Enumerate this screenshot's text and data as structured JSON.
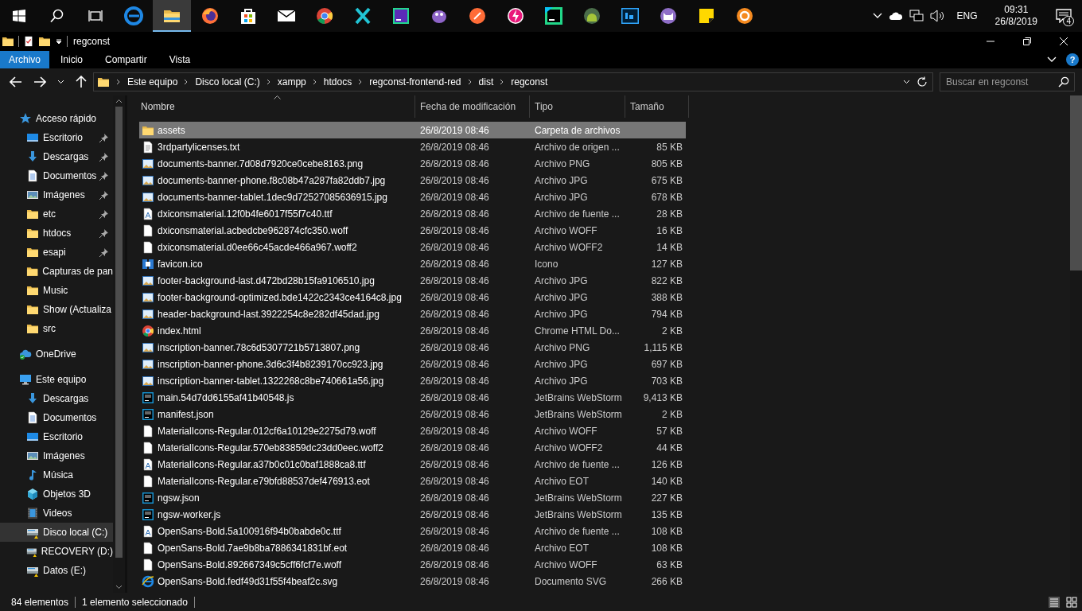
{
  "taskbar": {
    "apps": [
      {
        "kind": "edge",
        "selected": false
      },
      {
        "kind": "explorer",
        "selected": true
      },
      {
        "kind": "firefox",
        "selected": false
      },
      {
        "kind": "store",
        "selected": false
      },
      {
        "kind": "mail",
        "selected": false
      },
      {
        "kind": "chrome",
        "selected": false
      },
      {
        "kind": "xapp",
        "selected": false
      },
      {
        "kind": "dg",
        "selected": false
      },
      {
        "kind": "bird",
        "selected": false
      },
      {
        "kind": "postman",
        "selected": false
      },
      {
        "kind": "bolt",
        "selected": false
      },
      {
        "kind": "ws",
        "selected": false
      },
      {
        "kind": "android",
        "selected": false
      },
      {
        "kind": "ps",
        "selected": false
      },
      {
        "kind": "cat",
        "selected": false
      },
      {
        "kind": "sticky",
        "selected": false
      },
      {
        "kind": "coin",
        "selected": false
      }
    ],
    "language": "ENG",
    "time": "09:31",
    "date": "26/8/2019",
    "notification_count": "4"
  },
  "window": {
    "title": "regconst"
  },
  "ribbon": {
    "tabs": [
      {
        "label": "Archivo",
        "selected": true
      },
      {
        "label": "Inicio",
        "selected": false
      },
      {
        "label": "Compartir",
        "selected": false
      },
      {
        "label": "Vista",
        "selected": false
      }
    ],
    "help": "?"
  },
  "address": {
    "path": [
      "Este equipo",
      "Disco local (C:)",
      "xampp",
      "htdocs",
      "regconst-frontend-red",
      "dist",
      "regconst"
    ],
    "search": {
      "placeholder": "Buscar en regconst"
    }
  },
  "navigation": {
    "sections": [
      {
        "label": "Acceso rápido",
        "kind": "star",
        "selected": false,
        "children": [
          {
            "label": "Escritorio",
            "kind": "desktop",
            "pinned": true,
            "selected": false
          },
          {
            "label": "Descargas",
            "kind": "download",
            "pinned": true,
            "selected": false
          },
          {
            "label": "Documentos",
            "kind": "doc",
            "pinned": true,
            "selected": false
          },
          {
            "label": "Imágenes",
            "kind": "pictures",
            "pinned": true,
            "selected": false
          },
          {
            "label": "etc",
            "kind": "folder",
            "pinned": true,
            "selected": false
          },
          {
            "label": "htdocs",
            "kind": "folder",
            "pinned": true,
            "selected": false
          },
          {
            "label": "esapi",
            "kind": "folder",
            "pinned": true,
            "selected": false
          },
          {
            "label": "Capturas de pan",
            "kind": "folder",
            "pinned": false,
            "selected": false
          },
          {
            "label": "Music",
            "kind": "folder",
            "pinned": false,
            "selected": false
          },
          {
            "label": "Show (Actualiza",
            "kind": "folder",
            "pinned": false,
            "selected": false
          },
          {
            "label": "src",
            "kind": "folder",
            "pinned": false,
            "selected": false
          }
        ]
      },
      {
        "label": "OneDrive",
        "kind": "cloud",
        "selected": false
      },
      {
        "label": "Este equipo",
        "kind": "pc",
        "selected": false,
        "children": [
          {
            "label": "Descargas",
            "kind": "download",
            "pinned": false,
            "selected": false
          },
          {
            "label": "Documentos",
            "kind": "doc",
            "pinned": false,
            "selected": false
          },
          {
            "label": "Escritorio",
            "kind": "desktop",
            "pinned": false,
            "selected": false
          },
          {
            "label": "Imágenes",
            "kind": "pictures",
            "pinned": false,
            "selected": false
          },
          {
            "label": "Música",
            "kind": "music",
            "pinned": false,
            "selected": false
          },
          {
            "label": "Objetos 3D",
            "kind": "cube",
            "pinned": false,
            "selected": false
          },
          {
            "label": "Videos",
            "kind": "video",
            "pinned": false,
            "selected": false
          },
          {
            "label": "Disco local (C:)",
            "kind": "drive",
            "pinned": false,
            "selected": true
          },
          {
            "label": "RECOVERY (D:)",
            "kind": "drive",
            "pinned": false,
            "selected": false
          },
          {
            "label": "Datos (E:)",
            "kind": "drive",
            "pinned": false,
            "selected": false
          }
        ]
      }
    ]
  },
  "table": {
    "columns": [
      {
        "label": "Nombre",
        "sorted": true
      },
      {
        "label": "Fecha de modificación",
        "sorted": false
      },
      {
        "label": "Tipo",
        "sorted": false
      },
      {
        "label": "Tamaño",
        "sorted": false
      }
    ],
    "rows": [
      {
        "kind": "folder",
        "name": "assets",
        "modified": "26/8/2019 08:46",
        "type": "Carpeta de archivos",
        "selected": true
      },
      {
        "kind": "text",
        "name": "3rdpartylicenses.txt",
        "modified": "26/8/2019 08:46",
        "type": "Archivo de origen ...",
        "size": "85 KB",
        "selected": false
      },
      {
        "kind": "image",
        "name": "documents-banner.7d08d7920ce0cebe8163.png",
        "modified": "26/8/2019 08:46",
        "type": "Archivo PNG",
        "size": "805 KB",
        "selected": false
      },
      {
        "kind": "image",
        "name": "documents-banner-phone.f8c08b47a287fa82ddb7.jpg",
        "modified": "26/8/2019 08:46",
        "type": "Archivo JPG",
        "size": "675 KB",
        "selected": false
      },
      {
        "kind": "image",
        "name": "documents-banner-tablet.1dec9d72527085636915.jpg",
        "modified": "26/8/2019 08:46",
        "type": "Archivo JPG",
        "size": "678 KB",
        "selected": false
      },
      {
        "kind": "font",
        "name": "dxiconsmaterial.12f0b4fe6017f55f7c40.ttf",
        "modified": "26/8/2019 08:46",
        "type": "Archivo de fuente ...",
        "size": "28 KB",
        "selected": false
      },
      {
        "kind": "blank",
        "name": "dxiconsmaterial.acbedcbe962874cfc350.woff",
        "modified": "26/8/2019 08:46",
        "type": "Archivo WOFF",
        "size": "16 KB",
        "selected": false
      },
      {
        "kind": "blank",
        "name": "dxiconsmaterial.d0ee66c45acde466a967.woff2",
        "modified": "26/8/2019 08:46",
        "type": "Archivo WOFF2",
        "size": "14 KB",
        "selected": false
      },
      {
        "kind": "favicon",
        "name": "favicon.ico",
        "modified": "26/8/2019 08:46",
        "type": "Icono",
        "size": "127 KB",
        "selected": false
      },
      {
        "kind": "image",
        "name": "footer-background-last.d472bd28b15fa9106510.jpg",
        "modified": "26/8/2019 08:46",
        "type": "Archivo JPG",
        "size": "822 KB",
        "selected": false
      },
      {
        "kind": "image",
        "name": "footer-background-optimized.bde1422c2343ce4164c8.jpg",
        "modified": "26/8/2019 08:46",
        "type": "Archivo JPG",
        "size": "388 KB",
        "selected": false
      },
      {
        "kind": "image",
        "name": "header-background-last.3922254c8e282df45dad.jpg",
        "modified": "26/8/2019 08:46",
        "type": "Archivo JPG",
        "size": "794 KB",
        "selected": false
      },
      {
        "kind": "chrome",
        "name": "index.html",
        "modified": "26/8/2019 08:46",
        "type": "Chrome HTML Do...",
        "size": "2 KB",
        "selected": false
      },
      {
        "kind": "image",
        "name": "inscription-banner.78c6d5307721b5713807.png",
        "modified": "26/8/2019 08:46",
        "type": "Archivo PNG",
        "size": "1,115 KB",
        "selected": false
      },
      {
        "kind": "image",
        "name": "inscription-banner-phone.3d6c3f4b8239170cc923.jpg",
        "modified": "26/8/2019 08:46",
        "type": "Archivo JPG",
        "size": "697 KB",
        "selected": false
      },
      {
        "kind": "image",
        "name": "inscription-banner-tablet.1322268c8be740661a56.jpg",
        "modified": "26/8/2019 08:46",
        "type": "Archivo JPG",
        "size": "703 KB",
        "selected": false
      },
      {
        "kind": "ws",
        "name": "main.54d7dd6155af41b40548.js",
        "modified": "26/8/2019 08:46",
        "type": "JetBrains WebStorm",
        "size": "9,413 KB",
        "selected": false
      },
      {
        "kind": "ws",
        "name": "manifest.json",
        "modified": "26/8/2019 08:46",
        "type": "JetBrains WebStorm",
        "size": "2 KB",
        "selected": false
      },
      {
        "kind": "blank",
        "name": "MaterialIcons-Regular.012cf6a10129e2275d79.woff",
        "modified": "26/8/2019 08:46",
        "type": "Archivo WOFF",
        "size": "57 KB",
        "selected": false
      },
      {
        "kind": "blank",
        "name": "MaterialIcons-Regular.570eb83859dc23dd0eec.woff2",
        "modified": "26/8/2019 08:46",
        "type": "Archivo WOFF2",
        "size": "44 KB",
        "selected": false
      },
      {
        "kind": "font",
        "name": "MaterialIcons-Regular.a37b0c01c0baf1888ca8.ttf",
        "modified": "26/8/2019 08:46",
        "type": "Archivo de fuente ...",
        "size": "126 KB",
        "selected": false
      },
      {
        "kind": "blank",
        "name": "MaterialIcons-Regular.e79bfd88537def476913.eot",
        "modified": "26/8/2019 08:46",
        "type": "Archivo EOT",
        "size": "140 KB",
        "selected": false
      },
      {
        "kind": "ws",
        "name": "ngsw.json",
        "modified": "26/8/2019 08:46",
        "type": "JetBrains WebStorm",
        "size": "227 KB",
        "selected": false
      },
      {
        "kind": "ws",
        "name": "ngsw-worker.js",
        "modified": "26/8/2019 08:46",
        "type": "JetBrains WebStorm",
        "size": "135 KB",
        "selected": false
      },
      {
        "kind": "font",
        "name": "OpenSans-Bold.5a100916f94b0babde0c.ttf",
        "modified": "26/8/2019 08:46",
        "type": "Archivo de fuente ...",
        "size": "108 KB",
        "selected": false
      },
      {
        "kind": "blank",
        "name": "OpenSans-Bold.7ae9b8ba7886341831bf.eot",
        "modified": "26/8/2019 08:46",
        "type": "Archivo EOT",
        "size": "108 KB",
        "selected": false
      },
      {
        "kind": "blank",
        "name": "OpenSans-Bold.892667349c5cff6fcf7e.woff",
        "modified": "26/8/2019 08:46",
        "type": "Archivo WOFF",
        "size": "63 KB",
        "selected": false
      },
      {
        "kind": "ie",
        "name": "OpenSans-Bold.fedf49d31f55f4beaf2c.svg",
        "modified": "26/8/2019 08:46",
        "type": "Documento SVG",
        "size": "266 KB",
        "selected": false
      }
    ]
  },
  "status_bar": {
    "item_count": "84 elementos",
    "selection": "1 elemento seleccionado"
  }
}
